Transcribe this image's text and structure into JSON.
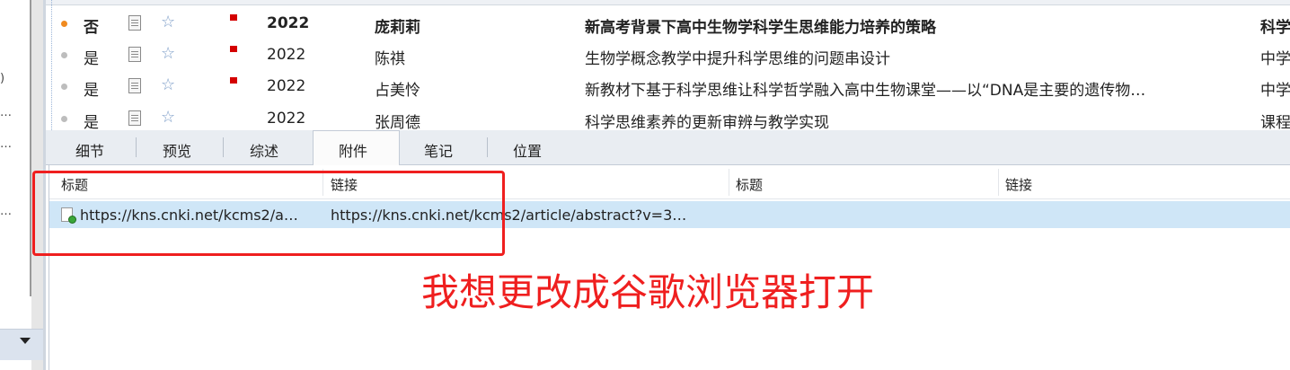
{
  "left_panel": {
    "partial_marks": [
      ")",
      "…",
      "…",
      "…"
    ]
  },
  "table": {
    "rows": [
      {
        "read": "否",
        "year": "2022",
        "author": "庞莉莉",
        "title": "新高考背景下高中生物学科学生思维能力培养的策略",
        "source": "科学",
        "bold": true,
        "unread": true
      },
      {
        "read": "是",
        "year": "2022",
        "author": "陈祺",
        "title": "生物学概念教学中提升科学思维的问题串设计",
        "source": "中学",
        "bold": false,
        "unread": false
      },
      {
        "read": "是",
        "year": "2022",
        "author": "占美怜",
        "title": "新教材下基于科学思维让科学哲学融入高中生物课堂——以“DNA是主要的遗传物…",
        "source": "中学",
        "bold": false,
        "unread": false
      },
      {
        "read": "是",
        "year": "2022",
        "author": "张周德",
        "title": "科学思维素养的更新审辨与教学实现",
        "source": "课程",
        "bold": false,
        "unread": false
      }
    ]
  },
  "tabs": [
    {
      "label": "细节"
    },
    {
      "label": "预览"
    },
    {
      "label": "综述"
    },
    {
      "label": "附件"
    },
    {
      "label": "笔记"
    },
    {
      "label": "位置"
    }
  ],
  "active_tab": "附件",
  "attachments": {
    "headers": [
      "标题",
      "链接",
      "标题",
      "链接"
    ],
    "rows": [
      {
        "title": "https://kns.cnki.net/kcms2/a…",
        "link": "https://kns.cnki.net/kcms2/article/abstract?v=3…"
      }
    ]
  },
  "annotation": {
    "text": "我想更改成谷歌浏览器打开",
    "color": "#ef1f1f"
  },
  "colors": {
    "selection": "#cfe6f7",
    "unread_dot": "#f08a20",
    "flag": "#d40000"
  }
}
